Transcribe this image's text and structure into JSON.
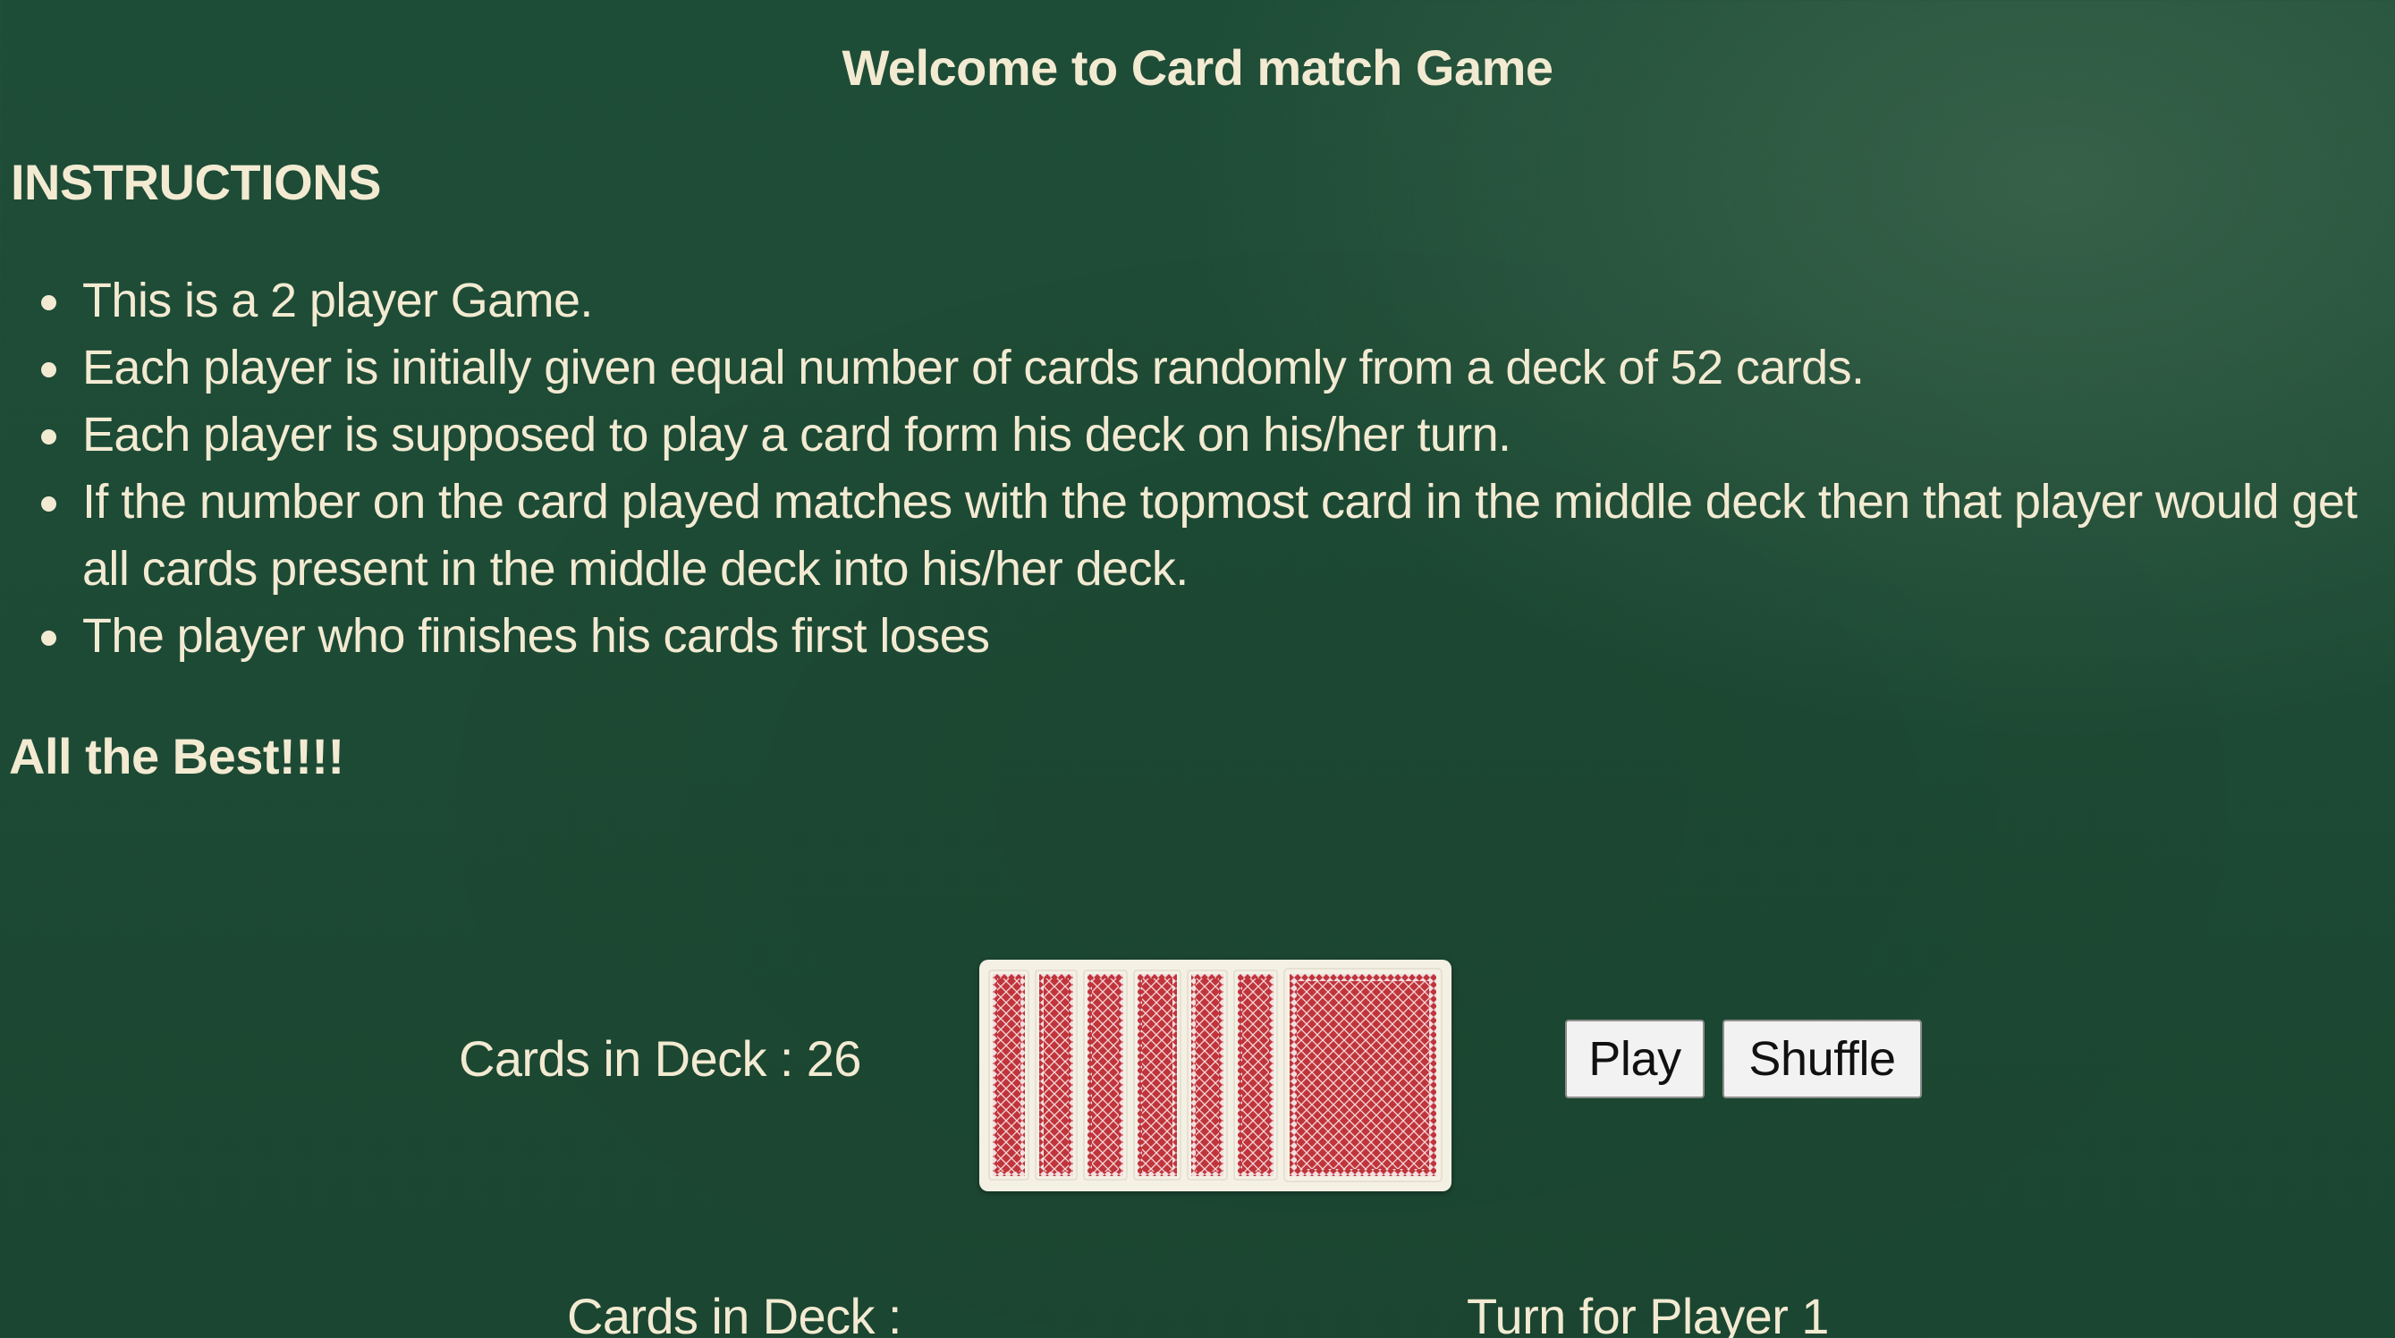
{
  "header": {
    "title": "Welcome to Card match Game"
  },
  "instructions": {
    "heading": "INSTRUCTIONS",
    "items": [
      "This is a 2 player Game.",
      "Each player is initially given equal number of cards randomly from a deck of 52 cards.",
      "Each player is supposed to play a card form his deck on his/her turn.",
      "If the number on the card played matches with the topmost card in the middle deck then that player would get all cards present in the middle deck into his/her deck.",
      "The player who finishes his cards first loses"
    ],
    "farewell": "All the Best!!!!"
  },
  "game": {
    "deck_count_label": "Cards in Deck : 26",
    "bottom_deck_count_label": "Cards in Deck :",
    "turn_label": "Turn for Player 1",
    "play_button": "Play",
    "shuffle_button": "Shuffle",
    "card_back_icon": "card-back-stack-icon",
    "colors": {
      "felt": "#1e4d37",
      "card_back": "#c0343c",
      "card_border": "#f4f0e4",
      "text": "#f3ead2"
    }
  }
}
